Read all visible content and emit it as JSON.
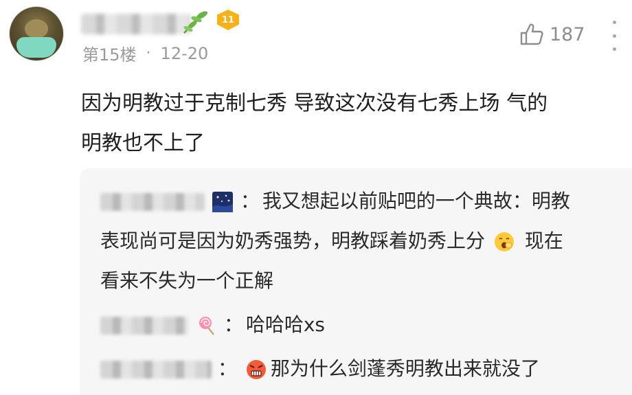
{
  "post": {
    "floor": "第15楼",
    "separator": "·",
    "date": "12-20",
    "likes": "187",
    "level": "11",
    "content_line1": "因为明教过于克制七秀 导致这次没有七秀上场 气的",
    "content_line2": "明教也不上了"
  },
  "replies": [
    {
      "colon": "：",
      "line1": "我又想起以前贴吧的一个典故：明教",
      "line2a": "表现尚可是因为奶秀强势，明教踩着奶秀上分",
      "line2b": "现在",
      "line3": "看来不失为一个正解"
    },
    {
      "colon": "：",
      "text": "哈哈哈xs"
    },
    {
      "colon": "：",
      "text": "那为什么剑蓬秀明教出来就没了"
    }
  ],
  "colors": {
    "accent_badge": "#f6b21a",
    "reply_bg": "#f6f6f6",
    "meta": "#9a9a9a"
  },
  "icons": [
    "avatar",
    "leaf-icon",
    "level-badge-icon",
    "thumb-up-icon",
    "more-icon",
    "starry-night-icon",
    "lollipop-icon",
    "yawn-emoji-icon",
    "angry-emoji-icon"
  ]
}
